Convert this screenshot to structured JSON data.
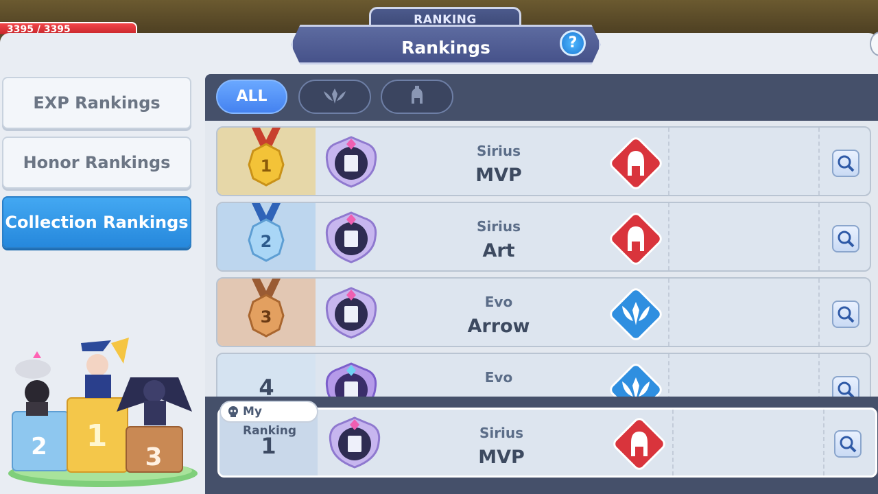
{
  "hud": {
    "hp_text": "3395 / 3395"
  },
  "header": {
    "tab_label": "RANKING",
    "title": "Rankings",
    "help_label": "?"
  },
  "sidebar": {
    "tabs": [
      {
        "label": "EXP Rankings",
        "active": false
      },
      {
        "label": "Honor Rankings",
        "active": false
      },
      {
        "label": "Collection Rankings",
        "active": true
      }
    ]
  },
  "podium": {
    "places": [
      "2",
      "1",
      "3"
    ]
  },
  "filters": {
    "all_label": "ALL",
    "icons": [
      "wings-emblem-icon",
      "helmet-icon"
    ]
  },
  "rows": [
    {
      "rank": "1",
      "guild": "Sirius",
      "name": "MVP",
      "emblem": "helmet-icon",
      "medal": "gold"
    },
    {
      "rank": "2",
      "guild": "Sirius",
      "name": "Art",
      "emblem": "helmet-icon",
      "medal": "silver"
    },
    {
      "rank": "3",
      "guild": "Evo",
      "name": "Arrow",
      "emblem": "wings-emblem-icon",
      "medal": "bronze"
    },
    {
      "rank": "4",
      "guild": "Evo",
      "name": "",
      "emblem": "wings-emblem-icon",
      "medal": "none"
    }
  ],
  "my_ranking": {
    "tag": "My Ranking",
    "rank": "1",
    "guild": "Sirius",
    "name": "MVP",
    "emblem": "helmet-icon"
  },
  "colors": {
    "accent_blue": "#2f8fe0",
    "gold": "#f1c232",
    "silver": "#8fc6ee",
    "bronze": "#d8904c",
    "helmet_red": "#d9343c",
    "wings_blue": "#2f8fe0"
  }
}
